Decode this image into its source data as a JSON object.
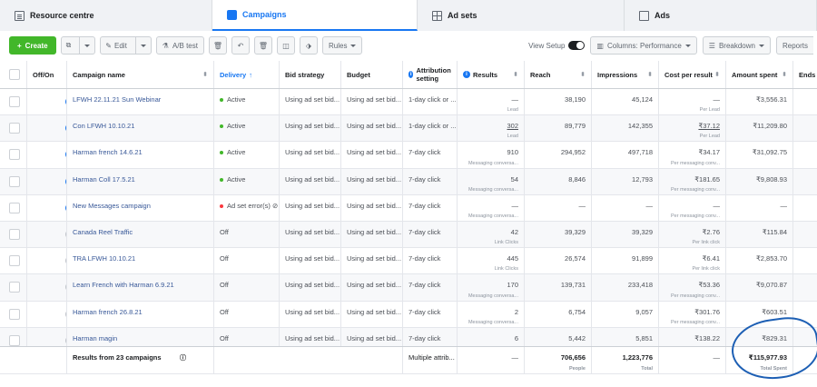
{
  "tabs": [
    {
      "label": "Resource centre",
      "icon": "document-icon"
    },
    {
      "label": "Campaigns",
      "icon": "campaign-icon",
      "active": true
    },
    {
      "label": "Ad sets",
      "icon": "grid-icon"
    },
    {
      "label": "Ads",
      "icon": "ad-icon"
    }
  ],
  "toolbar": {
    "create_label": "Create",
    "edit_label": "Edit",
    "ab_test_label": "A/B test",
    "rules_label": "Rules",
    "view_setup_label": "View Setup",
    "columns_label": "Columns: Performance",
    "breakdown_label": "Breakdown",
    "reports_label": "Reports"
  },
  "columns": {
    "off_on": "Off/On",
    "campaign_name": "Campaign name",
    "delivery": "Delivery",
    "delivery_mark": "↑",
    "bid_strategy": "Bid strategy",
    "budget": "Budget",
    "attribution": "Attribution setting",
    "results": "Results",
    "reach": "Reach",
    "impressions": "Impressions",
    "cost_per_result": "Cost per result",
    "amount_spent": "Amount spent",
    "ends": "Ends"
  },
  "rows": [
    {
      "on": true,
      "name": "LFWH 22.11.21 Sun Webinar",
      "delivery": "Active",
      "status": "active",
      "bid": "Using ad set bid...",
      "budget": "Using ad set bid...",
      "attribution": "1-day click or ...",
      "results": "—",
      "results_sub": "Lead",
      "reach": "38,190",
      "impressions": "45,124",
      "cpr": "—",
      "cpr_sub": "Per Lead",
      "spent": "₹3,556.31"
    },
    {
      "on": true,
      "name": "Con LFWH 10.10.21",
      "delivery": "Active",
      "status": "active",
      "bid": "Using ad set bid...",
      "budget": "Using ad set bid...",
      "attribution": "1-day click or ...",
      "results": "302",
      "results_sub": "Lead",
      "reach": "89,779",
      "impressions": "142,355",
      "cpr": "₹37.12",
      "cpr_sub": "Per Lead",
      "spent": "₹11,209.80"
    },
    {
      "on": true,
      "name": "Harman french 14.6.21",
      "delivery": "Active",
      "status": "active",
      "bid": "Using ad set bid...",
      "budget": "Using ad set bid...",
      "attribution": "7-day click",
      "results": "910",
      "results_sub": "Messaging conversa...",
      "reach": "294,952",
      "impressions": "497,718",
      "cpr": "₹34.17",
      "cpr_sub": "Per messaging conv...",
      "spent": "₹31,092.75"
    },
    {
      "on": true,
      "name": "Harman Coll 17.5.21",
      "delivery": "Active",
      "status": "active",
      "bid": "Using ad set bid...",
      "budget": "Using ad set bid...",
      "attribution": "7-day click",
      "results": "54",
      "results_sub": "Messaging conversa...",
      "reach": "8,846",
      "impressions": "12,793",
      "cpr": "₹181.65",
      "cpr_sub": "Per messaging conv...",
      "spent": "₹9,808.93"
    },
    {
      "on": true,
      "name": "New Messages campaign",
      "delivery": "Ad set error(s)",
      "status": "error",
      "bid": "Using ad set bid...",
      "budget": "Using ad set bid...",
      "attribution": "7-day click",
      "results": "—",
      "results_sub": "Messaging conversa...",
      "reach": "—",
      "impressions": "—",
      "cpr": "—",
      "cpr_sub": "Per messaging conv...",
      "spent": "—"
    },
    {
      "on": false,
      "name": "Canada Reel Traffic",
      "delivery": "Off",
      "status": "off",
      "bid": "Using ad set bid...",
      "budget": "Using ad set bid...",
      "attribution": "7-day click",
      "results": "42",
      "results_sub": "Link Clicks",
      "reach": "39,329",
      "impressions": "39,329",
      "cpr": "₹2.76",
      "cpr_sub": "Per link click",
      "spent": "₹115.84"
    },
    {
      "on": false,
      "name": "TRA LFWH 10.10.21",
      "delivery": "Off",
      "status": "off",
      "bid": "Using ad set bid...",
      "budget": "Using ad set bid...",
      "attribution": "7-day click",
      "results": "445",
      "results_sub": "Link Clicks",
      "reach": "26,574",
      "impressions": "91,899",
      "cpr": "₹6.41",
      "cpr_sub": "Per link click",
      "spent": "₹2,853.70"
    },
    {
      "on": false,
      "name": "Learn French with Harman 6.9.21",
      "delivery": "Off",
      "status": "off",
      "bid": "Using ad set bid...",
      "budget": "Using ad set bid...",
      "attribution": "7-day click",
      "results": "170",
      "results_sub": "Messaging conversa...",
      "reach": "139,731",
      "impressions": "233,418",
      "cpr": "₹53.36",
      "cpr_sub": "Per messaging conv...",
      "spent": "₹9,070.87"
    },
    {
      "on": false,
      "name": "Harman french 26.8.21",
      "delivery": "Off",
      "status": "off",
      "bid": "Using ad set bid...",
      "budget": "Using ad set bid...",
      "attribution": "7-day click",
      "results": "2",
      "results_sub": "Messaging conversa...",
      "reach": "6,754",
      "impressions": "9,057",
      "cpr": "₹301.76",
      "cpr_sub": "Per messaging conv...",
      "spent": "₹603.51"
    },
    {
      "on": false,
      "name": "Harman magin",
      "delivery": "Off",
      "status": "off",
      "bid": "Using ad set bid...",
      "budget": "Using ad set bid...",
      "attribution": "7-day click",
      "results": "6",
      "results_sub": "",
      "reach": "5,442",
      "impressions": "5,851",
      "cpr": "₹138.22",
      "cpr_sub": "",
      "spent": "₹829.31"
    }
  ],
  "summary": {
    "label": "Results from 23 campaigns",
    "attribution": "Multiple attrib...",
    "results": "—",
    "reach": "706,656",
    "reach_sub": "People",
    "impressions": "1,223,776",
    "impressions_sub": "Total",
    "cpr": "—",
    "spent": "₹115,977.93",
    "spent_sub": "Total Spent"
  }
}
